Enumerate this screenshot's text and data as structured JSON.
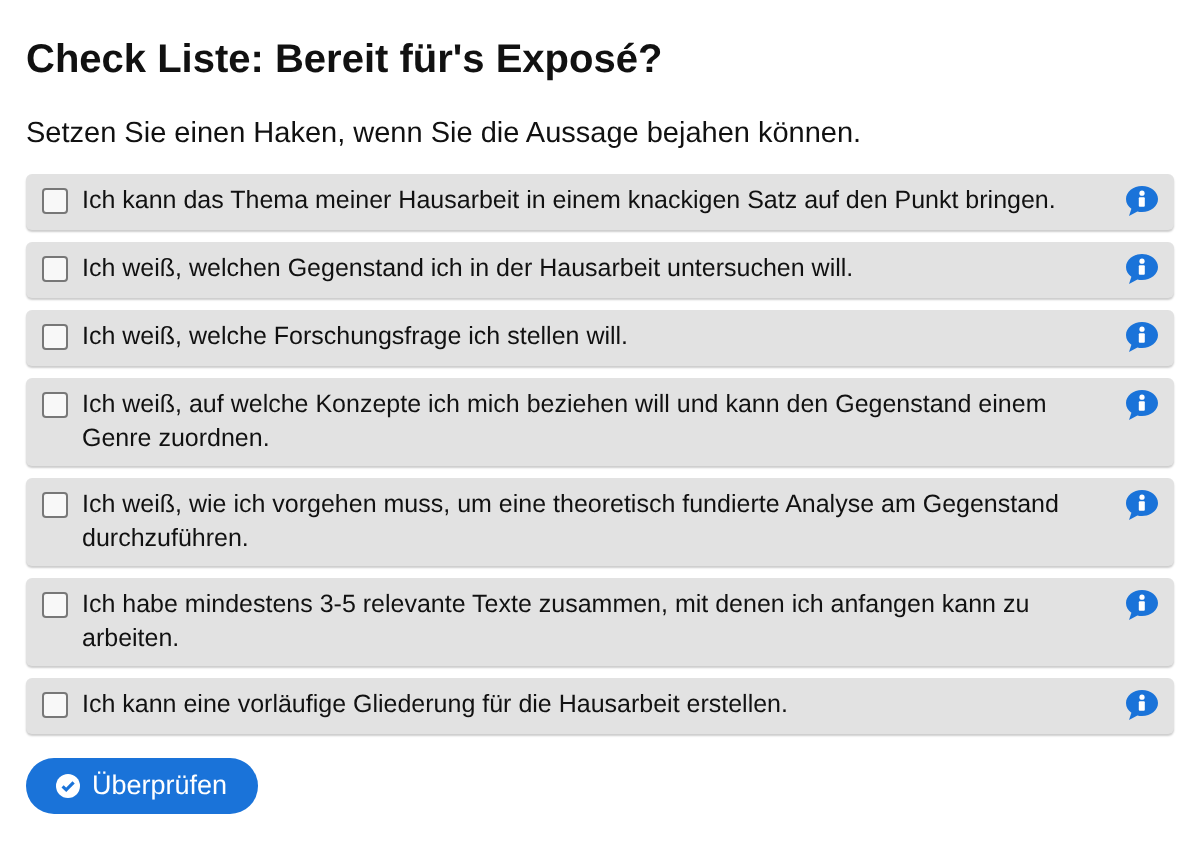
{
  "title": "Check Liste: Bereit für's Exposé?",
  "instruction": "Setzen Sie einen Haken, wenn Sie die Aussage bejahen können.",
  "items": [
    {
      "text": "Ich kann das Thema meiner Hausarbeit in einem knackigen Satz auf den Punkt bringen.",
      "checked": false
    },
    {
      "text": "Ich weiß, welchen Gegenstand ich in der Hausarbeit untersuchen will.",
      "checked": false
    },
    {
      "text": "Ich weiß, welche Forschungsfrage ich stellen will.",
      "checked": false
    },
    {
      "text": "Ich weiß, auf welche Konzepte ich mich beziehen will und kann den Gegenstand einem Genre zuordnen.",
      "checked": false
    },
    {
      "text": "Ich weiß, wie ich vorgehen muss, um eine theoretisch fundierte Analyse am Gegenstand durchzuführen.",
      "checked": false
    },
    {
      "text": "Ich habe mindestens 3-5 relevante Texte zusammen, mit denen ich anfangen kann zu arbeiten.",
      "checked": false
    },
    {
      "text": "Ich kann eine vorläufige Gliederung für die Hausarbeit erstellen.",
      "checked": false
    }
  ],
  "button": "Überprüfen"
}
